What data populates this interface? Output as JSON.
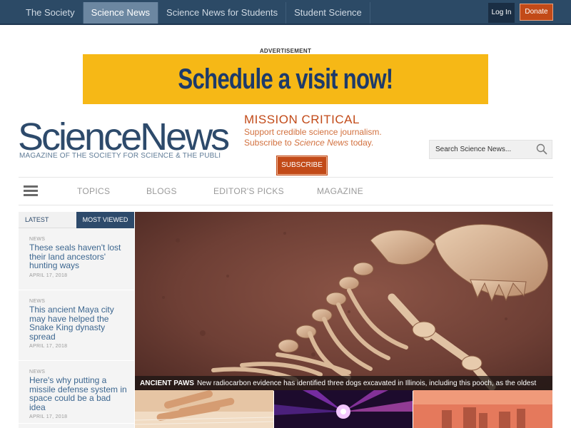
{
  "topnav": {
    "items": [
      {
        "label": "The Society",
        "active": false
      },
      {
        "label": "Science News",
        "active": true
      },
      {
        "label": "Science News for Students",
        "active": false
      },
      {
        "label": "Student Science",
        "active": false
      }
    ],
    "login_label": "Log In",
    "donate_label": "Donate"
  },
  "ad": {
    "label": "ADVERTISEMENT",
    "text": "Schedule a visit now!"
  },
  "masthead": {
    "logo": "ScienceNews",
    "tagline": "MAGAZINE OF THE SOCIETY FOR SCIENCE & THE PUBLIC",
    "mission_title": "MISSION CRITICAL",
    "mission_line1": "Support credible science journalism.",
    "mission_line2_prefix": "Subscribe to ",
    "mission_line2_em": "Science News",
    "mission_line2_suffix": " today.",
    "subscribe_label": "SUBSCRIBE",
    "search_placeholder": "Search Science News..."
  },
  "secnav": {
    "links": [
      "TOPICS",
      "BLOGS",
      "EDITOR'S PICKS",
      "MAGAZINE"
    ]
  },
  "sidebar": {
    "tab_latest": "LATEST",
    "tab_most_viewed": "MOST VIEWED",
    "stories": [
      {
        "category": "NEWS",
        "headline": "These seals haven't lost their land ancestors' hunting ways",
        "date": "APRIL 17, 2018"
      },
      {
        "category": "NEWS",
        "headline": "This ancient Maya city may have helped the Snake King dynasty spread",
        "date": "APRIL 17, 2018"
      },
      {
        "category": "NEWS",
        "headline": "Here's why putting a missile defense system in space could be a bad idea",
        "date": "APRIL 17, 2018"
      }
    ]
  },
  "hero": {
    "kicker": "ANCIENT PAWS",
    "caption": "New radiocarbon evidence has identified three dogs excavated in Illinois, including this pooch, as the oldest"
  },
  "colors": {
    "navy": "#2c4a66",
    "accent_orange": "#c24a18",
    "ad_yellow": "#f6b816",
    "link_blue": "#3d6790"
  }
}
